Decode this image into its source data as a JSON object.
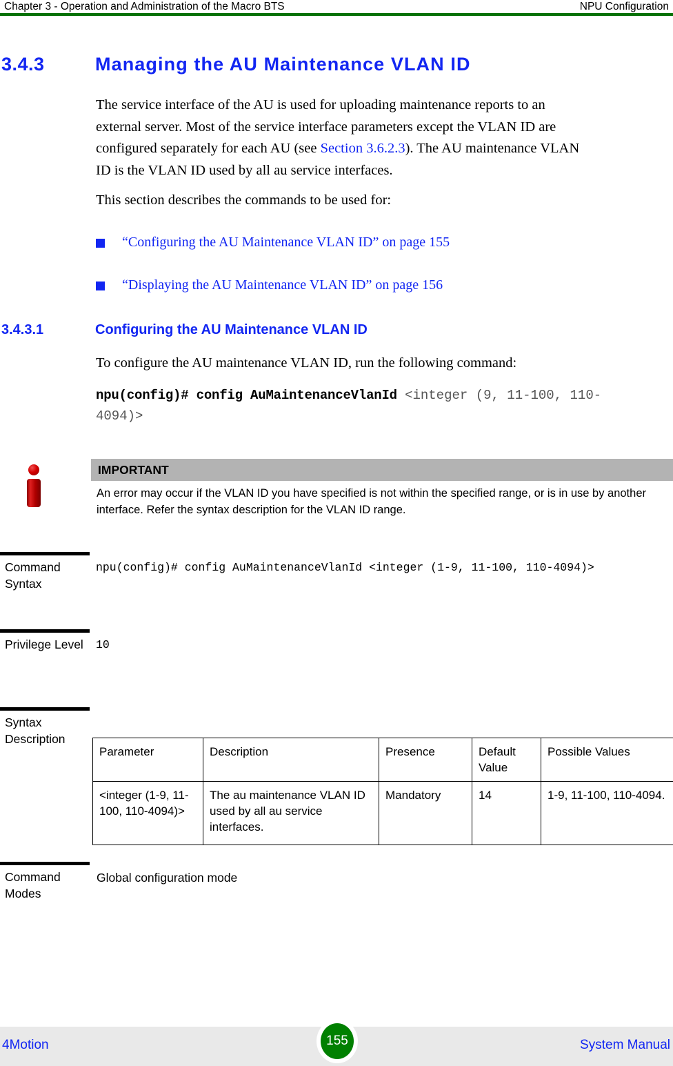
{
  "header": {
    "left": "Chapter 3 - Operation and Administration of the Macro BTS",
    "right": "NPU Configuration",
    "rule_color": "#067006"
  },
  "section": {
    "number": "3.4.3",
    "title": "Managing the AU Maintenance VLAN ID",
    "heading_color": "#1226f2"
  },
  "intro": {
    "paragraph_1_part_1": "The service interface of the AU is used for uploading maintenance reports to an external server. Most of the service interface parameters except the VLAN ID are configured separately for each AU (see ",
    "paragraph_1_xref": "Section 3.6.2.3",
    "paragraph_1_part_2": "). The AU maintenance VLAN ID is the VLAN ID used by all au service interfaces.",
    "paragraph_2": "This section describes the commands to be used for:"
  },
  "links": [
    {
      "label": "“Configuring the AU Maintenance VLAN ID” on page 155"
    },
    {
      "label": "“Displaying the AU Maintenance VLAN ID” on page 156"
    }
  ],
  "subsection": {
    "number": "3.4.3.1",
    "title": "Configuring the AU Maintenance VLAN ID",
    "lead_in": "To configure the AU maintenance VLAN ID, run the following command:",
    "command_bold": "npu(config)# config AuMaintenanceVlanId ",
    "command_arg": "<integer (9, 11-100, 110-4094)>"
  },
  "note": {
    "icon": "info-icon",
    "title": "IMPORTANT",
    "body": "An error may occur if the VLAN ID you have specified is not within the specified range, or is in use by another interface. Refer the syntax description for the VLAN ID range.",
    "header_bg": "#b3b3b3",
    "icon_color": "#c00000"
  },
  "definitions": [
    {
      "label": "Command Syntax",
      "value": "npu(config)# config AuMaintenanceVlanId <integer (1-9, 11-100, 110-4094)>"
    },
    {
      "label": "Privilege Level",
      "value": "10"
    },
    {
      "label": "Syntax Description",
      "value": ""
    },
    {
      "label": "Command Modes",
      "value": "Global configuration mode"
    }
  ],
  "param_table": {
    "columns": [
      "Parameter",
      "Description",
      "Presence",
      "Default Value",
      "Possible Values"
    ],
    "rows": [
      {
        "parameter": "<integer (1-9, 11-100, 110-4094)>",
        "description": "The au maintenance VLAN ID used by all au service interfaces.",
        "presence": "Mandatory",
        "default_value": "14",
        "possible_values": "1-9, 11-100, 110-4094."
      }
    ]
  },
  "footer": {
    "left": "4Motion",
    "page": "155",
    "right": "System Manual",
    "page_badge_color": "#008000",
    "band_color": "#e9e9e9"
  }
}
